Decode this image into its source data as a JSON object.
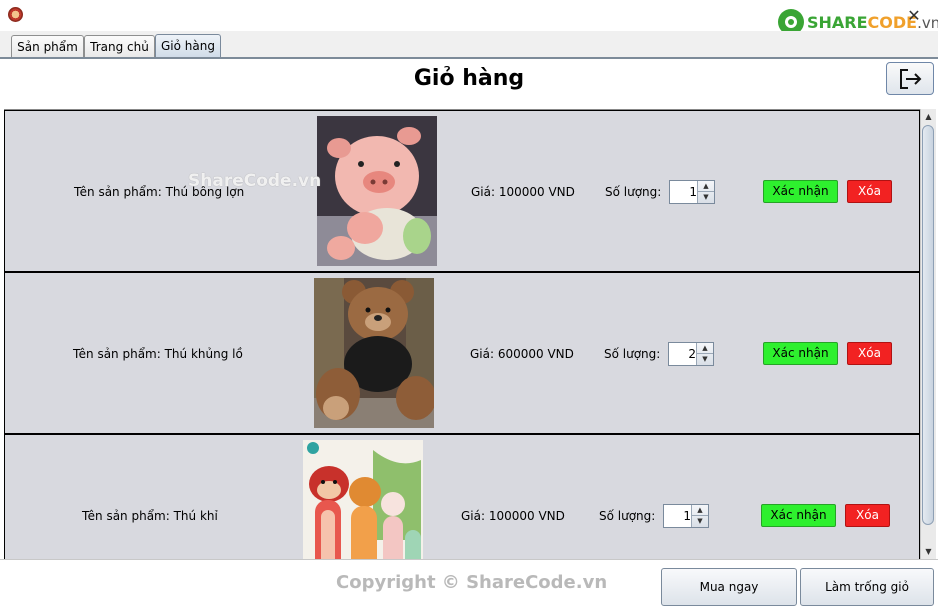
{
  "window": {
    "close_glyph": "✕",
    "logo": {
      "brand_part1": "SHARE",
      "brand_part2": "CODE",
      "brand_tld": ".vn"
    }
  },
  "tabs": [
    {
      "label": "Sản phẩm",
      "active": false
    },
    {
      "label": "Trang chủ",
      "active": false
    },
    {
      "label": "Giỏ hàng",
      "active": true
    }
  ],
  "page": {
    "title": "Giỏ hàng"
  },
  "cart": {
    "items": [
      {
        "name": "Tên sản phẩm: Thú bông lợn",
        "image": "pink-pig-plush-photo",
        "price": "Giá: 100000 VND",
        "qty_label": "Số lượng:",
        "qty": "1",
        "confirm_label": "Xác nhận",
        "delete_label": "Xóa"
      },
      {
        "name": "Tên sản phẩm: Thú khủng lồ",
        "image": "giant-teddy-bear-photo",
        "price": "Giá: 600000 VND",
        "qty_label": "Số lượng:",
        "qty": "2",
        "confirm_label": "Xác nhận",
        "delete_label": "Xóa"
      },
      {
        "name": "Tên sản phẩm: Thú khỉ",
        "image": "monkey-plush-photo",
        "price": "Giá: 100000 VND",
        "qty_label": "Số lượng:",
        "qty": "1",
        "confirm_label": "Xác nhận",
        "delete_label": "Xóa"
      }
    ]
  },
  "watermark": "ShareCode.vn",
  "footer": {
    "copyright": "Copyright © ShareCode.vn",
    "buy_label": "Mua ngay",
    "clear_label": "Làm trống giỏ"
  },
  "icons": {
    "app": "app-icon",
    "logout": "logout-icon",
    "spinner_up": "▲",
    "spinner_down": "▼"
  },
  "colors": {
    "confirm": "#2ef02e",
    "delete": "#f22222",
    "row_bg": "#d8d9df",
    "logo_green": "#3aa535",
    "logo_orange": "#f0a02b"
  }
}
